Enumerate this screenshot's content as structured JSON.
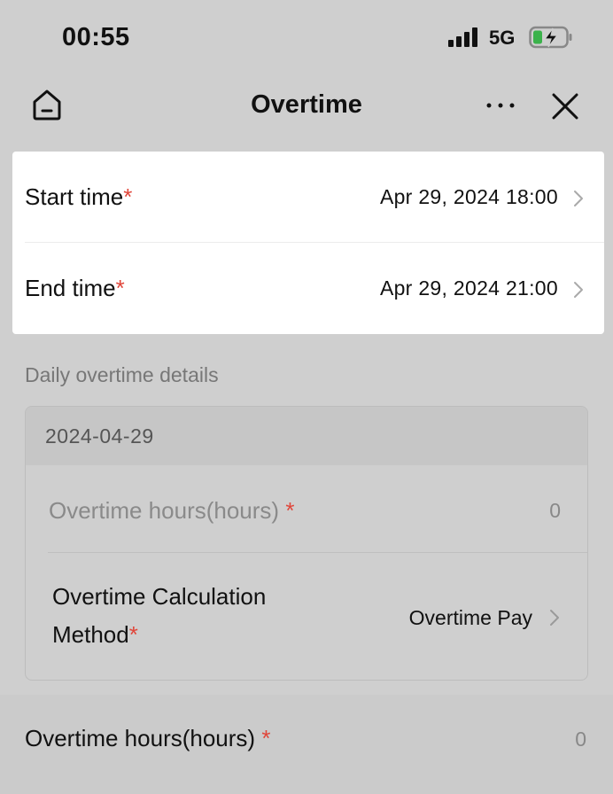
{
  "status_bar": {
    "time": "00:55",
    "network": "5G",
    "icons": [
      "signal-icon",
      "battery-charging-icon"
    ]
  },
  "nav": {
    "title": "Overtime",
    "icons": [
      "home-icon",
      "more-icon",
      "close-icon"
    ]
  },
  "form": {
    "start_time": {
      "label": "Start time",
      "required_mark": "*",
      "value": "Apr 29, 2024 18:00"
    },
    "end_time": {
      "label": "End time",
      "required_mark": "*",
      "value": "Apr 29, 2024 21:00"
    }
  },
  "daily_details": {
    "section_title": "Daily overtime details",
    "date": "2024-04-29",
    "hours_label": "Overtime hours(hours)",
    "hours_required": "*",
    "hours_value": "0",
    "method_label_line1": "Overtime Calculation",
    "method_label_line2": "Method",
    "method_required": "*",
    "method_value": "Overtime Pay"
  },
  "total": {
    "label": "Overtime hours(hours)",
    "required_mark": "*",
    "value": "0"
  },
  "colors": {
    "required": "#e0463a",
    "overlay_background": "#cfcfcf",
    "card_background": "#ffffff"
  }
}
